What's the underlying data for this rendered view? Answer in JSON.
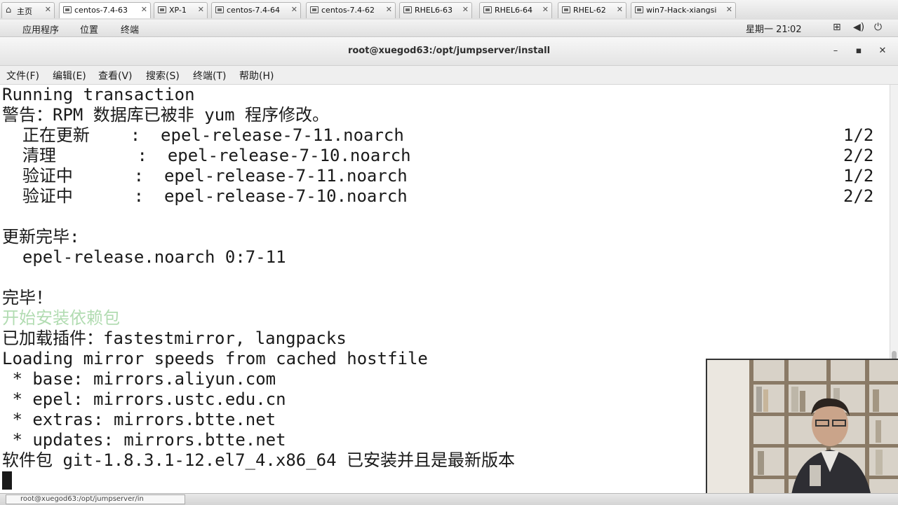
{
  "tabs": [
    {
      "label": "主页",
      "active": false
    },
    {
      "label": "centos-7.4-63",
      "active": true
    },
    {
      "label": "XP-1",
      "active": false
    },
    {
      "label": "centos-7.4-64",
      "active": false
    },
    {
      "label": "centos-7.4-62",
      "active": false
    },
    {
      "label": "RHEL6-63",
      "active": false
    },
    {
      "label": "RHEL6-64",
      "active": false
    },
    {
      "label": "RHEL-62",
      "active": false
    },
    {
      "label": "win7-Hack-xiangsi",
      "active": false
    }
  ],
  "gnome_panel": {
    "menus": [
      "应用程序",
      "位置",
      "终端"
    ],
    "clock": "星期一 21∶02",
    "icons": [
      "network-icon",
      "volume-icon",
      "power-icon"
    ]
  },
  "window": {
    "title": "root@xuegod63:/opt/jumpserver/install"
  },
  "menubar": [
    "文件(F)",
    "编辑(E)",
    "查看(V)",
    "搜索(S)",
    "终端(T)",
    "帮助(H)"
  ],
  "terminal": {
    "lines": [
      {
        "text": "Running transaction",
        "color": "normal"
      },
      {
        "text": "警告：RPM 数据库已被非 yum 程序修改。",
        "color": "normal"
      },
      {
        "text": "  正在更新    :  epel-release-7-11.noarch",
        "color": "normal",
        "right": "1/2"
      },
      {
        "text": "  清理        :  epel-release-7-10.noarch",
        "color": "normal",
        "right": "2/2"
      },
      {
        "text": "  验证中      :  epel-release-7-11.noarch",
        "color": "normal",
        "right": "1/2"
      },
      {
        "text": "  验证中      :  epel-release-7-10.noarch",
        "color": "normal",
        "right": "2/2"
      },
      {
        "text": "",
        "color": "normal"
      },
      {
        "text": "更新完毕:",
        "color": "normal"
      },
      {
        "text": "  epel-release.noarch 0:7-11",
        "color": "normal"
      },
      {
        "text": "",
        "color": "normal"
      },
      {
        "text": "完毕！",
        "color": "normal"
      },
      {
        "text": "开始安装依赖包",
        "color": "green"
      },
      {
        "text": "已加载插件：fastestmirror, langpacks",
        "color": "normal"
      },
      {
        "text": "Loading mirror speeds from cached hostfile",
        "color": "normal"
      },
      {
        "text": " * base: mirrors.aliyun.com",
        "color": "normal"
      },
      {
        "text": " * epel: mirrors.ustc.edu.cn",
        "color": "normal"
      },
      {
        "text": " * extras: mirrors.btte.net",
        "color": "normal"
      },
      {
        "text": " * updates: mirrors.btte.net",
        "color": "normal"
      },
      {
        "text": "软件包 git-1.8.3.1-12.el7_4.x86_64 已安装并且是最新版本",
        "color": "normal"
      }
    ]
  },
  "taskbar": {
    "task_label": "root@xuegod63:/opt/jumpserver/in"
  }
}
